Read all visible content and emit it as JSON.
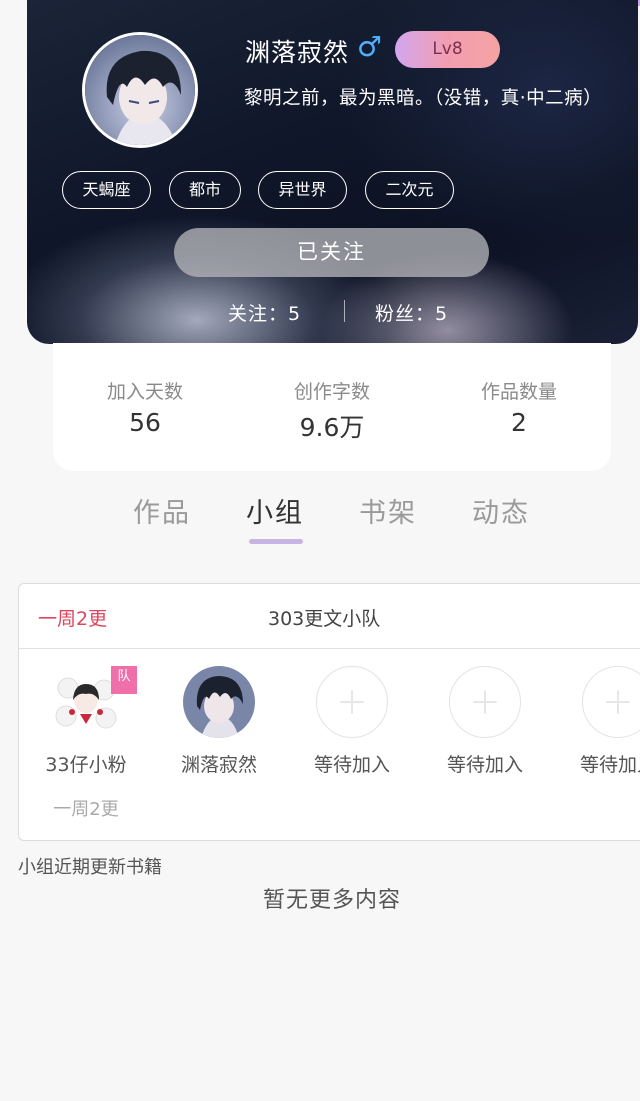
{
  "profile": {
    "nickname": "渊落寂然",
    "gender_icon": "male-icon",
    "level": "Lv8",
    "signature": "黎明之前，最为黑暗。（没错，真·中二病）",
    "tags": [
      "天蝎座",
      "都市",
      "异世界",
      "二次元"
    ],
    "follow_button": "已关注",
    "following_label": "关注：5",
    "fans_label": "粉丝：5"
  },
  "stats": [
    {
      "label": "加入天数",
      "value": "56"
    },
    {
      "label": "创作字数",
      "value": "9.6万"
    },
    {
      "label": "作品数量",
      "value": "2"
    }
  ],
  "tabs": [
    {
      "label": "作品"
    },
    {
      "label": "小组"
    },
    {
      "label": "书架"
    },
    {
      "label": "动态"
    }
  ],
  "active_tab": "小组",
  "group": {
    "frequency": "一周2更",
    "name": "303更文小队",
    "members": [
      {
        "name": "33仔小粉",
        "sub": "一周2更",
        "flag": "队"
      },
      {
        "name": "渊落寂然"
      },
      {
        "name": "等待加入"
      },
      {
        "name": "等待加入"
      },
      {
        "name": "等待加入"
      }
    ]
  },
  "recent_books_title": "小组近期更新书籍",
  "empty_text": "暂无更多内容",
  "colors": {
    "accent_red": "#e0445e",
    "tab_indicator": "#c8b4e4",
    "level_badge_start": "#d2a6ee",
    "level_badge_end": "#f4a3a3",
    "gender_blue": "#4fb0ff"
  }
}
